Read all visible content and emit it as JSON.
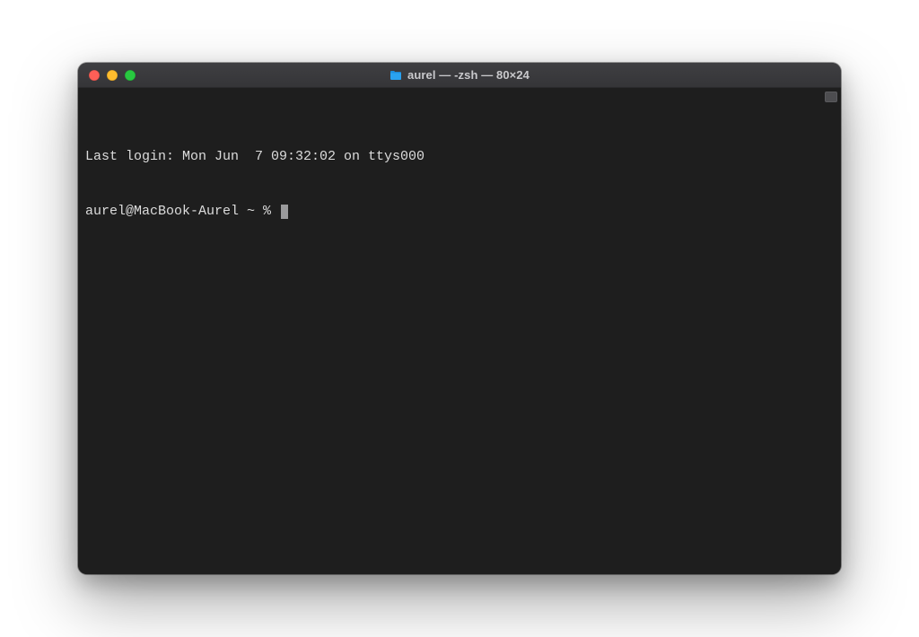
{
  "window": {
    "title": "aurel — -zsh — 80×24"
  },
  "terminal": {
    "last_login": "Last login: Mon Jun  7 09:32:02 on ttys000",
    "prompt": "aurel@MacBook-Aurel ~ % "
  },
  "colors": {
    "close": "#ff5f57",
    "minimize": "#febc2e",
    "zoom": "#28c840",
    "titlebar_text": "#c9c9cc",
    "terminal_bg": "#1e1e1e",
    "terminal_fg": "#dcdcdc"
  }
}
